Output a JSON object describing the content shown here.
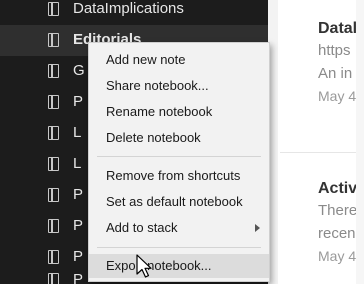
{
  "sidebar": {
    "items": [
      {
        "label": "DataImplications"
      },
      {
        "label": "Editorials"
      },
      {
        "label": "G"
      },
      {
        "label": "P"
      },
      {
        "label": "L"
      },
      {
        "label": "L"
      },
      {
        "label": "P"
      },
      {
        "label": "P"
      },
      {
        "label": "P"
      },
      {
        "label": "P"
      }
    ]
  },
  "notes": [
    {
      "title": "Datal",
      "line1": "https",
      "line2": "An in",
      "date": "May 4"
    },
    {
      "title": "Activ",
      "line1": "There",
      "line2": "recen",
      "date": "May 4"
    }
  ],
  "context_menu": {
    "groups": [
      [
        "Add new note",
        "Share notebook...",
        "Rename notebook",
        "Delete notebook"
      ],
      [
        "Remove from shortcuts",
        "Set as default notebook",
        "Add to stack"
      ],
      [
        "Export notebook..."
      ]
    ]
  }
}
